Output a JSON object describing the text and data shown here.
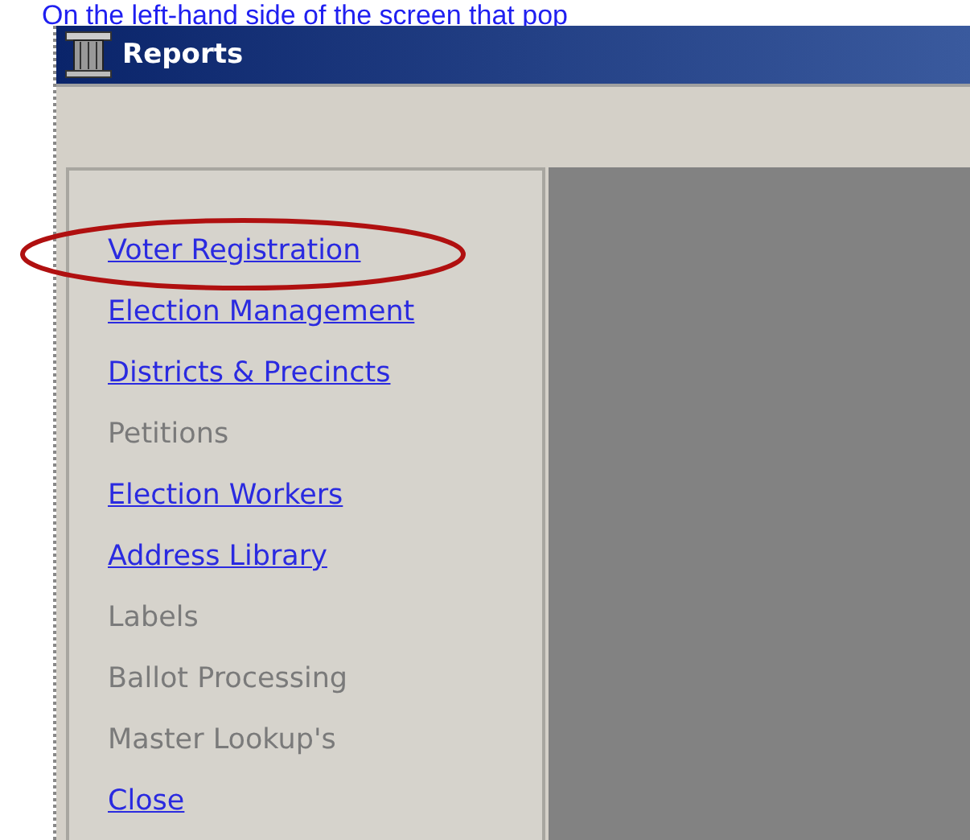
{
  "caption": "On the left-hand side of the screen that pop",
  "window": {
    "title": "Reports"
  },
  "menu": [
    {
      "label": "Voter Registration",
      "disabled": false,
      "circled": true
    },
    {
      "label": "Election Management",
      "disabled": false,
      "circled": false
    },
    {
      "label": "Districts & Precincts",
      "disabled": false,
      "circled": false
    },
    {
      "label": "Petitions",
      "disabled": true,
      "circled": false
    },
    {
      "label": "Election Workers",
      "disabled": false,
      "circled": false
    },
    {
      "label": "Address Library",
      "disabled": false,
      "circled": false
    },
    {
      "label": "Labels",
      "disabled": true,
      "circled": false
    },
    {
      "label": "Ballot Processing",
      "disabled": true,
      "circled": false
    },
    {
      "label": "Master Lookup's",
      "disabled": true,
      "circled": false
    },
    {
      "label": "Close",
      "disabled": false,
      "circled": false
    }
  ]
}
